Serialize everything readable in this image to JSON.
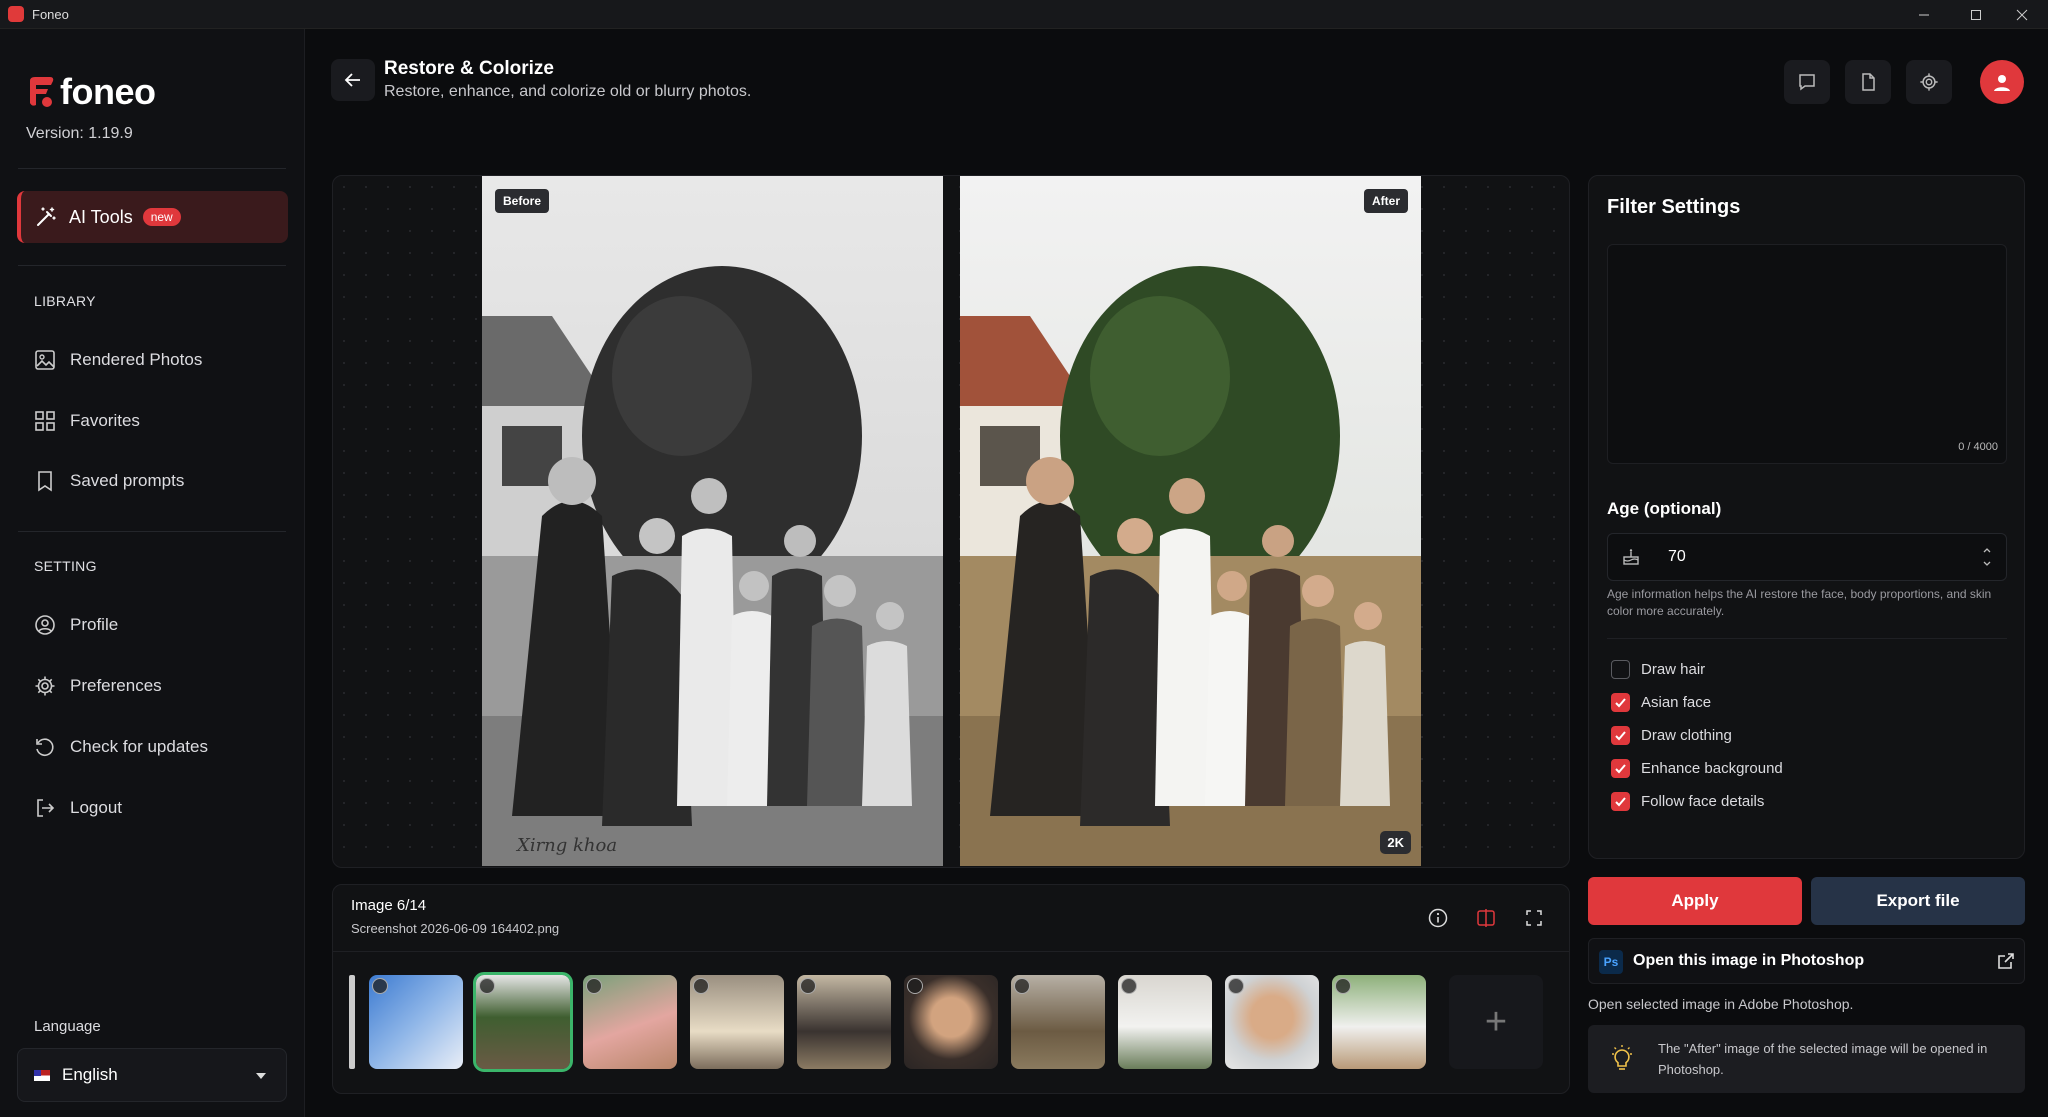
{
  "window": {
    "title": "Foneo",
    "controls": [
      "minimize",
      "maximize",
      "close"
    ]
  },
  "sidebar": {
    "logo_text": "foneo",
    "version": "Version: 1.19.9",
    "ai_tools": {
      "label": "AI Tools",
      "badge": "new"
    },
    "library_header": "LIBRARY",
    "library_items": [
      {
        "label": "Rendered Photos",
        "icon": "image-icon"
      },
      {
        "label": "Favorites",
        "icon": "grid-icon"
      },
      {
        "label": "Saved prompts",
        "icon": "bookmark-icon"
      }
    ],
    "setting_header": "SETTING",
    "setting_items": [
      {
        "label": "Profile",
        "icon": "user-circle-icon"
      },
      {
        "label": "Preferences",
        "icon": "gear-icon"
      },
      {
        "label": "Check for updates",
        "icon": "refresh-icon"
      },
      {
        "label": "Logout",
        "icon": "logout-icon"
      }
    ],
    "language_label": "Language",
    "language_value": "English"
  },
  "header": {
    "title": "Restore & Colorize",
    "subtitle": "Restore, enhance, and colorize old or blurry photos."
  },
  "viewer": {
    "before_label": "Before",
    "after_label": "After",
    "resolution_badge": "2K"
  },
  "image_info": {
    "index": "Image 6/14",
    "filename": "Screenshot 2026-06-09 164402.png",
    "thumbnail_count": 10,
    "selected_thumbnail": 2
  },
  "filter_settings": {
    "title": "Filter Settings",
    "prompt_counter": "0 / 4000",
    "age_label": "Age (optional)",
    "age_value": "70",
    "age_help": "Age information helps the AI restore the face, body proportions, and skin color more accurately.",
    "options": [
      {
        "label": "Draw hair",
        "checked": false
      },
      {
        "label": "Asian face",
        "checked": true
      },
      {
        "label": "Draw clothing",
        "checked": true
      },
      {
        "label": "Enhance background",
        "checked": true
      },
      {
        "label": "Follow face details",
        "checked": true
      }
    ]
  },
  "actions": {
    "apply_label": "Apply",
    "export_label": "Export file",
    "photoshop_icon_text": "Ps",
    "photoshop_label": "Open this image in Photoshop",
    "photoshop_desc": "Open selected image in Adobe Photoshop.",
    "photoshop_note": "The \"After\" image of the selected image will be opened in Photoshop."
  },
  "colors": {
    "accent": "#e0383c",
    "export": "#263347",
    "selected_thumb": "#3bb56a"
  }
}
